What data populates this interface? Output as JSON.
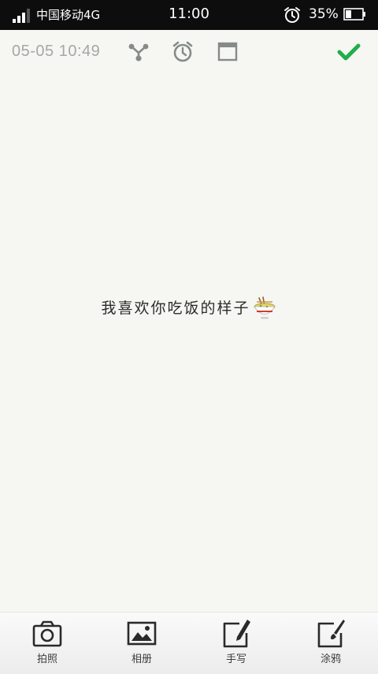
{
  "status_bar": {
    "carrier": "中国移动4G",
    "time": "11:00",
    "battery_percent": "35%",
    "battery_level": 0.35,
    "signal_bars": 3
  },
  "toolbar": {
    "timestamp": "05-05 10:49",
    "icons": [
      "share-icon",
      "alarm-clock-icon",
      "window-icon",
      "checkmark-icon"
    ],
    "accent_color": "#1fae4b"
  },
  "note": {
    "text": "我喜欢你吃饭的样子",
    "emoji": "noodle-bowl-icon"
  },
  "bottom_bar": {
    "items": [
      {
        "label": "拍照",
        "icon": "camera-icon"
      },
      {
        "label": "相册",
        "icon": "picture-icon"
      },
      {
        "label": "手写",
        "icon": "handwrite-icon"
      },
      {
        "label": "涂鸦",
        "icon": "brush-icon"
      }
    ]
  }
}
